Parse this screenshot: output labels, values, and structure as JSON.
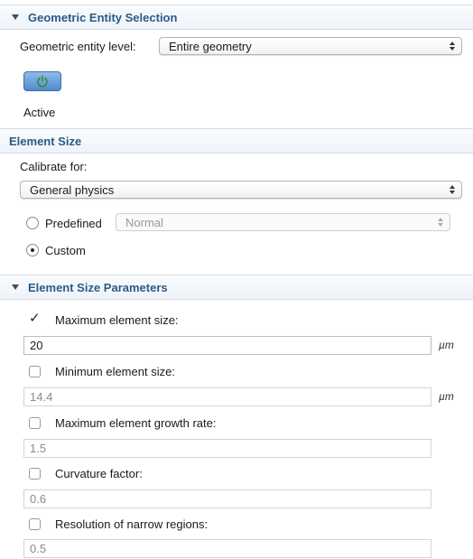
{
  "geometric_selection": {
    "header": "Geometric Entity Selection",
    "level_label": "Geometric entity level:",
    "level_value": "Entire geometry",
    "active_icon": "power-icon",
    "active_label": "Active"
  },
  "element_size": {
    "header": "Element Size",
    "calibrate_label": "Calibrate for:",
    "calibrate_value": "General physics",
    "predefined_label": "Predefined",
    "predefined_value": "Normal",
    "custom_label": "Custom",
    "selected": "Custom"
  },
  "parameters": {
    "header": "Element Size Parameters",
    "max_size": {
      "label": "Maximum element size:",
      "checked": true,
      "value": "20",
      "unit": "µm"
    },
    "min_size": {
      "label": "Minimum element size:",
      "checked": false,
      "value": "14.4",
      "unit": "µm"
    },
    "growth_rate": {
      "label": "Maximum element growth rate:",
      "checked": false,
      "value": "1.5"
    },
    "curvature": {
      "label": "Curvature factor:",
      "checked": false,
      "value": "0.6"
    },
    "narrow": {
      "label": "Resolution of narrow regions:",
      "checked": false,
      "value": "0.5"
    }
  }
}
